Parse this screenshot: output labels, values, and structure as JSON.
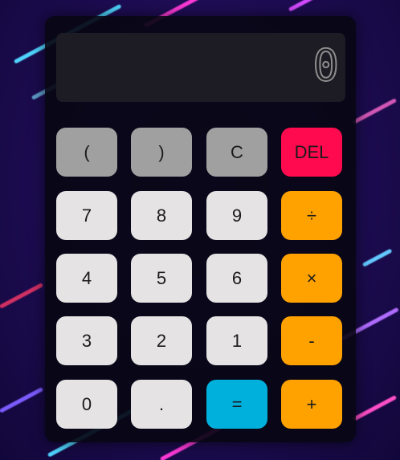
{
  "display": {
    "value": "0"
  },
  "colors": {
    "function": "#a0a0a0",
    "digit": "#e5e3e4",
    "delete": "#ff0a4e",
    "operator": "#ffa200",
    "equals": "#00b0dc"
  },
  "buttons": {
    "open_paren": "(",
    "close_paren": ")",
    "clear": "C",
    "delete": "DEL",
    "seven": "7",
    "eight": "8",
    "nine": "9",
    "divide": "÷",
    "four": "4",
    "five": "5",
    "six": "6",
    "multiply": "×",
    "three": "3",
    "two": "2",
    "one": "1",
    "subtract": "-",
    "zero": "0",
    "decimal": ".",
    "equals": "=",
    "add": "+"
  }
}
